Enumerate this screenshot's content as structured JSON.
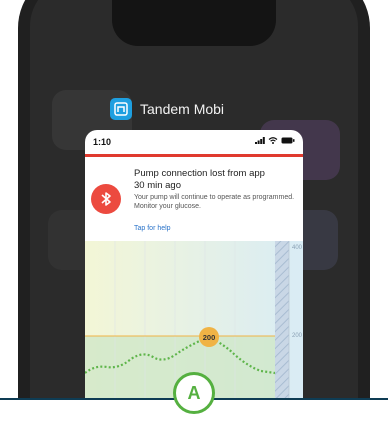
{
  "app": {
    "name": "Tandem Mobi",
    "status_time": "1:10"
  },
  "notification": {
    "title": "Pump connection lost from app",
    "age": "30 min ago",
    "body": "Your pump will continue to operate as programmed. Monitor your glucose.",
    "link": "Tap for help"
  },
  "chart_data": {
    "type": "line",
    "y_tick_labels": [
      "400",
      "200"
    ],
    "threshold_marker": "200"
  },
  "callout": {
    "label": "A"
  },
  "colors": {
    "accent_red": "#e03a2f",
    "bluetooth_red": "#ec4a3f",
    "link_blue": "#2a73c9",
    "marker_green": "#55b040",
    "threshold_orange": "#f0b345",
    "app_icon_blue": "#1e9fe0"
  },
  "icons": [
    "app-icon",
    "signal-icon",
    "wifi-icon",
    "battery-icon",
    "bluetooth-icon"
  ]
}
